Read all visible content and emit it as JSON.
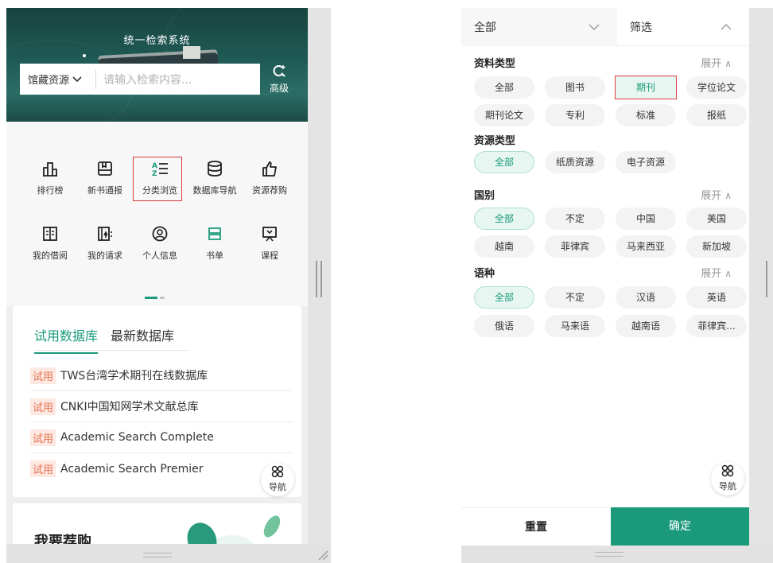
{
  "left": {
    "hero_title": "统一检索系统",
    "search": {
      "scope": "馆藏资源",
      "placeholder": "请输入检索内容...",
      "advanced_label": "高级"
    },
    "features": [
      {
        "icon": "ranking-icon",
        "label": "排行榜"
      },
      {
        "icon": "new-books-icon",
        "label": "新书通报"
      },
      {
        "icon": "category-sort-icon",
        "label": "分类浏览"
      },
      {
        "icon": "database-icon",
        "label": "数据库导航"
      },
      {
        "icon": "thumbs-up-icon",
        "label": "资源荐购"
      },
      {
        "icon": "book-open-icon",
        "label": "我的借阅"
      },
      {
        "icon": "request-icon",
        "label": "我的请求"
      },
      {
        "icon": "user-icon",
        "label": "个人信息"
      },
      {
        "icon": "booklist-icon",
        "label": "书单"
      },
      {
        "icon": "course-icon",
        "label": "课程"
      }
    ],
    "db_tabs": [
      "试用数据库",
      "最新数据库"
    ],
    "trial_tag": "试用",
    "databases": [
      "TWS台湾学术期刊在线数据库",
      "CNKI中国知网学术文献总库",
      "Academic Search Complete",
      "Academic Search Premier"
    ],
    "nav_label": "导航",
    "recommend_title": "我要荐购"
  },
  "right": {
    "dropdown_all": "全部",
    "dropdown_filter": "筛选",
    "expand_label": "展开",
    "sections": {
      "material_type": {
        "title": "资料类型",
        "chips": [
          "全部",
          "图书",
          "期刊",
          "学位论文",
          "期刊论文",
          "专利",
          "标准",
          "报纸"
        ]
      },
      "resource_type": {
        "title": "资源类型",
        "chips": [
          "全部",
          "纸质资源",
          "电子资源"
        ]
      },
      "country": {
        "title": "国别",
        "chips": [
          "全部",
          "不定",
          "中国",
          "美国",
          "越南",
          "菲律宾",
          "马来西亚",
          "新加坡"
        ]
      },
      "language": {
        "title": "语种",
        "chips": [
          "全部",
          "不定",
          "汉语",
          "英语",
          "俄语",
          "马来语",
          "越南语",
          "菲律宾..."
        ]
      }
    },
    "nav_label": "导航",
    "reset_label": "重置",
    "confirm_label": "确定"
  },
  "colors": {
    "accent": "#1a9a7b",
    "highlight_border": "#e0393f",
    "trial_text": "#e5704f"
  }
}
